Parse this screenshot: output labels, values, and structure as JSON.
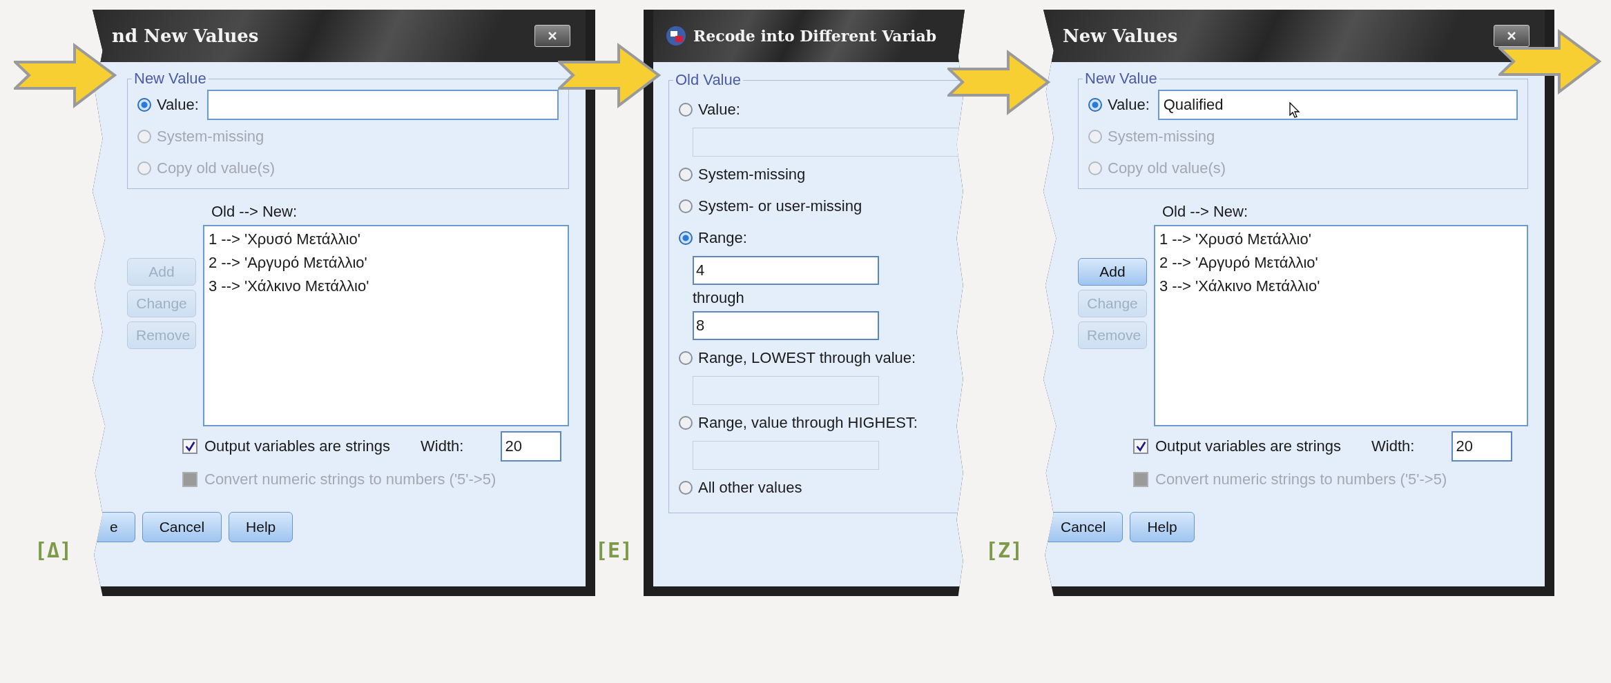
{
  "panels": [
    {
      "kind": "new_values",
      "tag": "[Δ]",
      "title": "nd New Values",
      "group_title": "New Value",
      "options": [
        {
          "label": "Value:",
          "selected": true,
          "disabled": false
        },
        {
          "label": "System-missing",
          "selected": false,
          "disabled": true
        },
        {
          "label": "Copy old value(s)",
          "selected": false,
          "disabled": true
        }
      ],
      "list_label": "Old --> New:",
      "mappings": [
        "1 --> 'Χρυσό Μετάλλιο'",
        "2 --> 'Αργυρό Μετάλλιο'",
        "3 --> 'Χάλκινο Μετάλλιο'"
      ],
      "side_buttons": [
        {
          "label": "Add",
          "disabled": true
        },
        {
          "label": "Change",
          "disabled": true
        },
        {
          "label": "Remove",
          "disabled": true
        }
      ],
      "checkboxes": [
        {
          "label": "Output variables are strings",
          "checked": true,
          "disabled": false
        },
        {
          "label": "Convert numeric strings to numbers ('5'->5)",
          "checked": false,
          "disabled": true
        }
      ],
      "width_label": "Width:",
      "width_value": "20",
      "footer_buttons": [
        "e",
        "Cancel",
        "Help"
      ]
    },
    {
      "kind": "old_value",
      "tag": "[E]",
      "title": "Recode into Different Variab",
      "group_title": "Old Value",
      "items": [
        {
          "kind": "radio",
          "label": "Value:",
          "selected": false
        },
        {
          "kind": "field",
          "disabled": true
        },
        {
          "kind": "radio",
          "label": "System-missing",
          "selected": false
        },
        {
          "kind": "radio",
          "label": "System- or user-missing",
          "selected": false
        },
        {
          "kind": "radio",
          "label": "Range:",
          "selected": true
        },
        {
          "kind": "field",
          "disabled": false,
          "value": "4"
        },
        {
          "kind": "text",
          "label": "through"
        },
        {
          "kind": "field",
          "disabled": false,
          "value": "8"
        },
        {
          "kind": "radio",
          "label": "Range, LOWEST through value:",
          "selected": false
        },
        {
          "kind": "field",
          "disabled": true
        },
        {
          "kind": "radio",
          "label": "Range, value through HIGHEST:",
          "selected": false
        },
        {
          "kind": "field",
          "disabled": true
        },
        {
          "kind": "radio",
          "label": "All other values",
          "selected": false
        }
      ]
    },
    {
      "kind": "new_values",
      "tag": "[Z]",
      "title": "New Values",
      "group_title": "New Value",
      "value": "Qualified",
      "options": [
        {
          "label": "Value:",
          "selected": true,
          "disabled": false
        },
        {
          "label": "System-missing",
          "selected": false,
          "disabled": true
        },
        {
          "label": "Copy old value(s)",
          "selected": false,
          "disabled": true
        }
      ],
      "list_label": "Old --> New:",
      "mappings": [
        "1 --> 'Χρυσό Μετάλλιο'",
        "2 --> 'Αργυρό Μετάλλιο'",
        "3 --> 'Χάλκινο Μετάλλιο'"
      ],
      "side_buttons": [
        {
          "label": "Add",
          "disabled": false
        },
        {
          "label": "Change",
          "disabled": true
        },
        {
          "label": "Remove",
          "disabled": true
        }
      ],
      "checkboxes": [
        {
          "label": "Output variables are strings",
          "checked": true,
          "disabled": false
        },
        {
          "label": "Convert numeric strings to numbers ('5'->5)",
          "checked": false,
          "disabled": true
        }
      ],
      "width_label": "Width:",
      "width_value": "20",
      "footer_buttons": [
        "Cancel",
        "Help"
      ]
    }
  ]
}
